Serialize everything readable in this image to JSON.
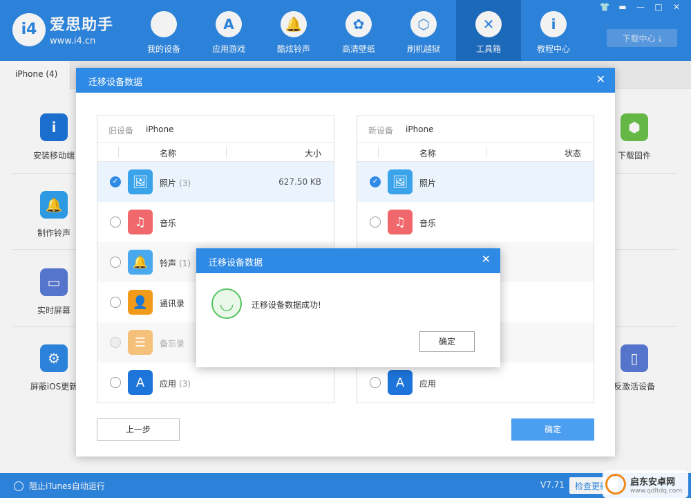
{
  "app": {
    "logo_badge": "i4",
    "name": "爱思助手",
    "url": "www.i4.cn",
    "download_center": "下载中心 ⤓",
    "window_controls": [
      "👕",
      "▬",
      "—",
      "□",
      "✕"
    ]
  },
  "nav": [
    {
      "label": "我的设备",
      "icon": ""
    },
    {
      "label": "应用游戏",
      "icon": "A"
    },
    {
      "label": "酷炫铃声",
      "icon": "🔔"
    },
    {
      "label": "高清壁纸",
      "icon": "✿"
    },
    {
      "label": "刷机越狱",
      "icon": "⬡"
    },
    {
      "label": "工具箱",
      "icon": "✕"
    },
    {
      "label": "教程中心",
      "icon": "i"
    }
  ],
  "tab": {
    "label": "iPhone (4)"
  },
  "tools": {
    "install_mobile": "安装移动端",
    "make_ringtone": "制作铃声",
    "realtime_screen": "实时屏幕",
    "block_ios_update": "屏蔽iOS更新",
    "download_firmware": "下载固件",
    "anti_activate": "反激活设备"
  },
  "statusbar": {
    "itunes_toggle": "阻止iTunes自动运行",
    "version": "V7.71",
    "check_update": "检查更新"
  },
  "dialog": {
    "title": "迁移设备数据",
    "close": "✕",
    "old_device": {
      "key": "旧设备",
      "value": "iPhone",
      "col_name": "名称",
      "col_extra": "大小"
    },
    "new_device": {
      "key": "新设备",
      "value": "iPhone",
      "col_name": "名称",
      "col_extra": "状态"
    },
    "old_items": [
      {
        "name": "照片",
        "count": "(3)",
        "size": "627.50 KB",
        "checked": true,
        "icon": "🖼",
        "color": "#3aa3ea"
      },
      {
        "name": "音乐",
        "count": "",
        "size": "",
        "checked": false,
        "icon": "♫",
        "color": "#f0686b"
      },
      {
        "name": "铃声",
        "count": "(1)",
        "size": "",
        "checked": false,
        "icon": "🔔",
        "color": "#4aa8ee"
      },
      {
        "name": "通讯录",
        "count": "",
        "size": "",
        "checked": false,
        "icon": "👤",
        "color": "#f29b1a"
      },
      {
        "name": "备忘录",
        "count": "",
        "size": "",
        "checked": false,
        "icon": "☰",
        "color": "#f5c07a"
      },
      {
        "name": "应用",
        "count": "(3)",
        "size": "",
        "checked": false,
        "icon": "A",
        "color": "#1d74d9"
      }
    ],
    "new_items": [
      {
        "name": "照片",
        "checked": true,
        "icon": "🖼",
        "color": "#3aa3ea"
      },
      {
        "name": "音乐",
        "checked": false,
        "icon": "♫",
        "color": "#f0686b"
      },
      {
        "name": "应用",
        "checked": false,
        "icon": "A",
        "color": "#1d74d9"
      }
    ],
    "prev_button": "上一步",
    "ok_button": "确定"
  },
  "success_dialog": {
    "title": "迁移设备数据",
    "close": "✕",
    "message": "迁移设备数据成功!",
    "ok_button": "确定",
    "icon": "◡"
  },
  "watermark": {
    "line1": "启东安卓网",
    "line2": "www.qdltdq.com"
  },
  "colors": {
    "primary": "#2f8ae5",
    "nav_active": "#1e6fc4",
    "success": "#55c25f"
  }
}
